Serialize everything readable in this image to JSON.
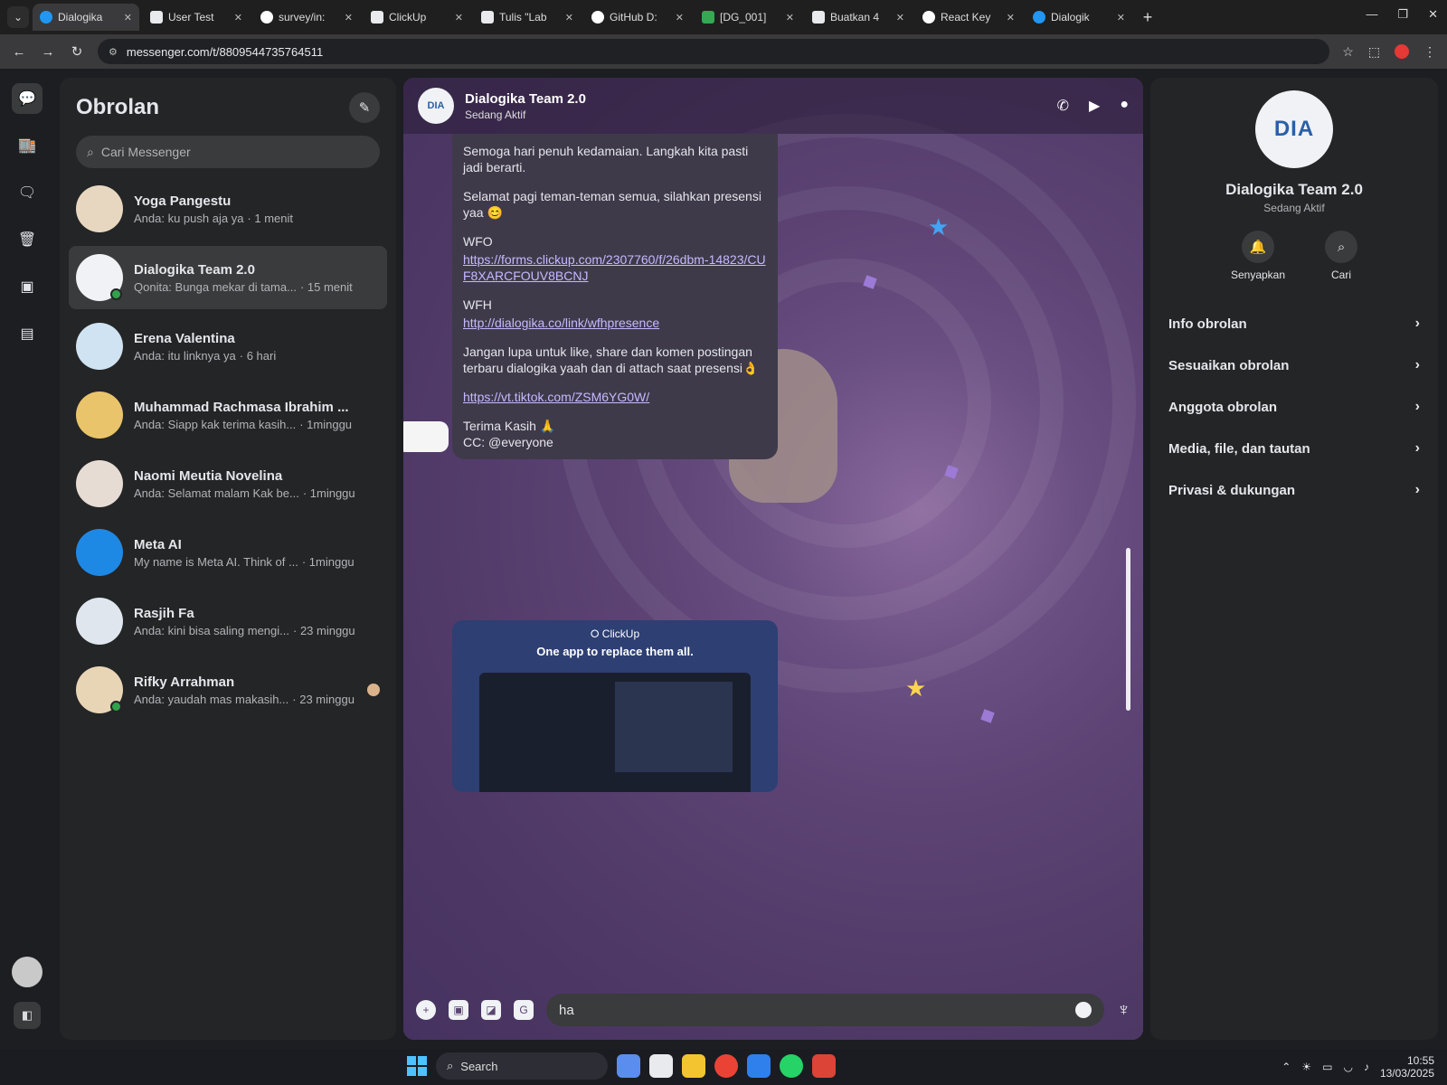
{
  "browser": {
    "tabs": [
      {
        "label": "Dialogika",
        "icon": "messenger-icon",
        "active": true
      },
      {
        "label": "User Test",
        "icon": "doc-icon"
      },
      {
        "label": "survey/in:",
        "icon": "github-icon"
      },
      {
        "label": "ClickUp",
        "icon": "doc-icon"
      },
      {
        "label": "Tulis \"Lab",
        "icon": "doc-icon"
      },
      {
        "label": "GitHub D:",
        "icon": "github-icon"
      },
      {
        "label": "[DG_001]",
        "icon": "sheet-icon"
      },
      {
        "label": "Buatkan 4",
        "icon": "doc-icon"
      },
      {
        "label": "React Key",
        "icon": "github-icon"
      },
      {
        "label": "Dialogik",
        "icon": "messenger-icon"
      }
    ],
    "url": "messenger.com/t/8809544735764511"
  },
  "sidebar": {
    "title": "Obrolan",
    "search_placeholder": "Cari Messenger",
    "chats": [
      {
        "name": "Yoga Pangestu",
        "preview": "Anda: ku push aja ya",
        "time": "1 menit",
        "avatar_color": "#e8d7c0",
        "online": false
      },
      {
        "name": "Dialogika Team 2.0",
        "preview": "Qonita: Bunga mekar di tama...",
        "time": "15 menit",
        "avatar_color": "#f0f2f5",
        "online": true,
        "active": true
      },
      {
        "name": "Erena Valentina",
        "preview": "Anda: itu linknya ya",
        "time": "6 hari",
        "avatar_color": "#cfe3f2",
        "online": false
      },
      {
        "name": "Muhammad Rachmasa Ibrahim ...",
        "preview": "Anda: Siapp kak terima kasih...",
        "time": "1minggu",
        "avatar_color": "#e9c46a",
        "online": false
      },
      {
        "name": "Naomi Meutia Novelina",
        "preview": "Anda: Selamat malam Kak be...",
        "time": "1minggu",
        "avatar_color": "#e6dcd3",
        "online": false
      },
      {
        "name": "Meta AI",
        "preview": "My name is Meta AI. Think of ...",
        "time": "1minggu",
        "avatar_color": "#1e88e5",
        "online": false
      },
      {
        "name": "Rasjih Fa",
        "preview": "Anda: kini bisa saling mengi...",
        "time": "23 minggu",
        "avatar_color": "#dfe6ee",
        "online": false
      },
      {
        "name": "Rifky Arrahman",
        "preview": "Anda: yaudah mas makasih...",
        "time": "23 minggu",
        "avatar_color": "#e8d5b5",
        "online": true
      }
    ]
  },
  "conversation": {
    "name": "Dialogika Team 2.0",
    "status": "Sedang Aktif",
    "avatar_text": "DIA",
    "message": {
      "lines": [
        "Semoga hari penuh kedamaian. Langkah kita pasti jadi berarti.",
        "Selamat pagi teman-teman semua, silahkan presensi yaa 😊"
      ],
      "wfo_label": "WFO",
      "wfo_link": "https://forms.clickup.com/2307760/f/26dbm-14823/CUF8XARCFOUV8BCNJ",
      "wfh_label": "WFH",
      "wfh_link": "http://dialogika.co/link/wfhpresence",
      "reminder": "Jangan lupa untuk like, share dan komen postingan terbaru dialogika yaah dan di attach saat presensi👌",
      "tiktok_link": "https://vt.tiktok.com/ZSM6YG0W/",
      "signoff": "Terima Kasih 🙏",
      "cc": "CC: @everyone"
    },
    "preview_card": {
      "title": "⭘ ClickUp",
      "subtitle": "One app to replace them all."
    },
    "composer_text": "ha"
  },
  "info_panel": {
    "avatar_text": "DIA",
    "name": "Dialogika Team 2.0",
    "status": "Sedang Aktif",
    "actions": [
      {
        "label": "Senyapkan",
        "icon": "bell-icon"
      },
      {
        "label": "Cari",
        "icon": "search-icon"
      }
    ],
    "sections": [
      "Info obrolan",
      "Sesuaikan obrolan",
      "Anggota obrolan",
      "Media, file, dan tautan",
      "Privasi & dukungan"
    ]
  },
  "taskbar": {
    "search_label": "Search",
    "time": "10:55",
    "date": "13/03/2025"
  },
  "colors": {
    "accent": "#0084ff",
    "chat_bg": "#5a4470",
    "panel_bg": "#242526",
    "online": "#31a24c"
  }
}
